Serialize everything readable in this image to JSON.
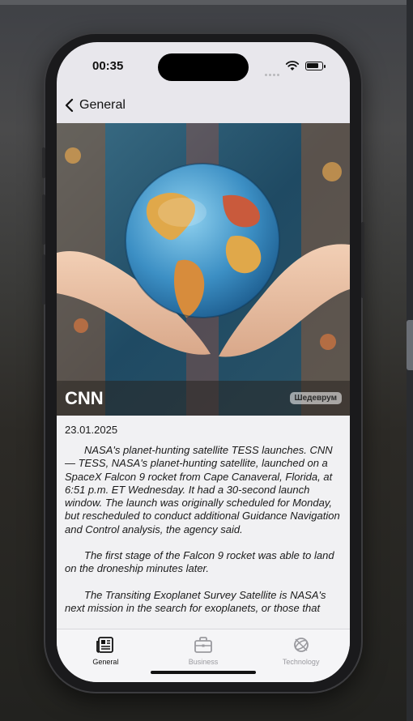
{
  "status_bar": {
    "time": "00:35"
  },
  "nav": {
    "back_label": "General"
  },
  "article": {
    "source": "CNN",
    "badge": "Шедеврум",
    "date": "23.01.2025",
    "paragraphs": [
      "NASA's planet-hunting satellite TESS launches. CNN — TESS, NASA's planet-hunting satellite, launched on a SpaceX Falcon 9 rocket from Cape Canaveral, Florida, at 6:51 p.m. ET Wednesday. It had a 30-second launch window. The launch was originally scheduled for Monday, but rescheduled to conduct additional Guidance Navigation and Control analysis, the agency said.",
      "The first stage of the Falcon 9 rocket was able to land on the droneship minutes later.",
      "The Transiting Exoplanet Survey Satellite is NASA's next mission in the search for exoplanets, or those that"
    ]
  },
  "tabs": [
    {
      "label": "General",
      "icon": "newspaper-icon",
      "active": true
    },
    {
      "label": "Business",
      "icon": "briefcase-icon",
      "active": false
    },
    {
      "label": "Technology",
      "icon": "globe-icon",
      "active": false
    }
  ],
  "colors": {
    "screen_bg": "#e8e7ec",
    "tab_active": "#111111",
    "tab_inactive": "#9a9a9f"
  },
  "battery_level": 0.85
}
